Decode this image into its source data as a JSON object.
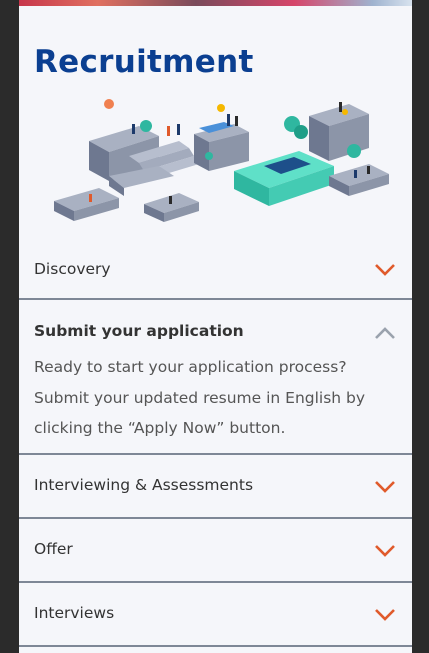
{
  "page": {
    "title": "Recruitment"
  },
  "accordion": {
    "items": [
      {
        "label": "Discovery",
        "expanded": false
      },
      {
        "label": "Submit your application",
        "expanded": true,
        "body": "Ready to start your application process? Submit your updated resume in English by clicking the “Apply Now” button."
      },
      {
        "label": "Interviewing & Assessments",
        "expanded": false
      },
      {
        "label": "Offer",
        "expanded": false
      },
      {
        "label": "Interviews",
        "expanded": false
      }
    ]
  },
  "colors": {
    "title": "#0b3f91",
    "chevron_collapsed": "#e05a2b",
    "chevron_expanded": "#9aa2ad",
    "panel_bg": "#f5f6fa"
  },
  "icons": {
    "collapsed": "chevron-down-icon",
    "expanded": "chevron-up-icon"
  }
}
